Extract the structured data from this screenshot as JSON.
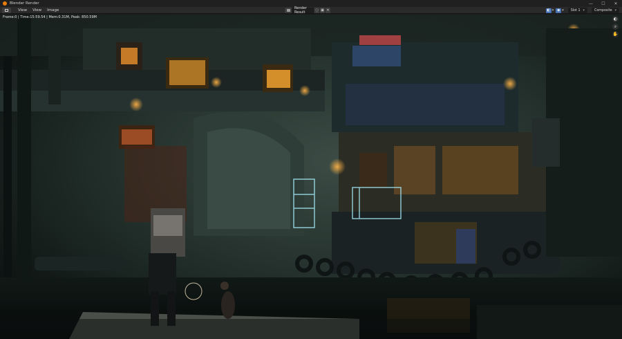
{
  "window": {
    "title": "Blender Render",
    "controls": {
      "minimize": "—",
      "maximize": "☐",
      "close": "✕"
    }
  },
  "header": {
    "menu": [
      "View",
      "View",
      "Image"
    ],
    "image_name": "Render Result",
    "slot_label": "Slot 1",
    "layer_label": "Composite"
  },
  "viewport": {
    "metadata": "Frame:0 | Time:15:59.54 | Mem:0.31M, Peak: 850.59M",
    "icons": [
      "eye-icon",
      "zoom-icon",
      "pan-hand-icon"
    ]
  },
  "colors": {
    "titlebar": "#202020",
    "header": "#2a2a2a",
    "accent": "#4772b3",
    "lamp_orange": "#f2a23a",
    "scene_fog": "#2b3a35"
  }
}
